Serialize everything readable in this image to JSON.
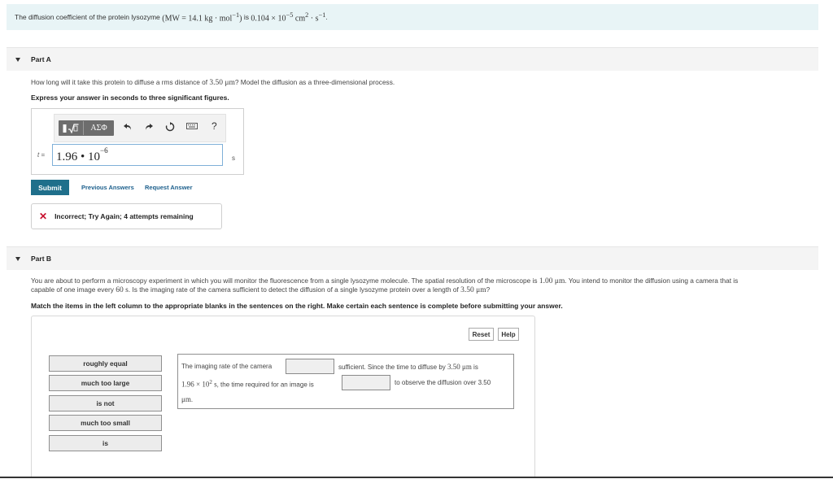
{
  "intro": {
    "text_a": "The diffusion coefficient of the protein lysozyme ",
    "mw": "(MW = 14.1 kg · mol",
    "mw_exp": "−1",
    "mw_close": ")",
    "text_b": " is ",
    "d_value": "0.104 × 10",
    "d_exp": "−5",
    "d_unit": " cm",
    "d_unit_exp": "2",
    "d_unit_b": " · s",
    "d_unit_b_exp": "−1",
    "text_c": "."
  },
  "part_a": {
    "title": "Part A",
    "question_a": "How long will it take this protein to diffuse a rms distance of ",
    "distance": "3.50 μm",
    "question_b": "? Model the diffusion as a three-dimensional process.",
    "instruction": "Express your answer in seconds to three significant figures.",
    "toolbar": {
      "greek_label": "ΑΣΦ",
      "help_label": "?"
    },
    "variable": "t",
    "equals": " =",
    "answer_mantissa": "1.96 • 10",
    "answer_exp": "−6",
    "unit": "s",
    "submit_label": "Submit",
    "previous_answers_label": "Previous Answers",
    "request_answer_label": "Request Answer",
    "feedback": "Incorrect; Try Again; 4 attempts remaining"
  },
  "part_b": {
    "title": "Part B",
    "question_line1_a": "You are about to perform a microscopy experiment in which you will monitor the fluorescence from a single lysozyme molecule. The spatial resolution of the microscope is ",
    "resolution": "1.00 μm",
    "question_line1_b": ". You intend to monitor the diffusion using a camera that is",
    "question_line2_a": "capable of one image every ",
    "interval": "60 s",
    "question_line2_b": ". Is the imaging rate of the camera sufficient to detect the diffusion of a single lysozyme protein over a length of ",
    "length": "3.50 μm",
    "question_line2_c": "?",
    "instruction": "Match the items in the left column to the appropriate blanks in the sentences on the right. Make certain each sentence is complete before submitting your answer.",
    "reset_label": "Reset",
    "help_label": "Help",
    "options": [
      "roughly equal",
      "much too large",
      "is not",
      "much too small",
      "is"
    ],
    "sentence": {
      "s1": "The imaging rate of the camera",
      "s2": "sufficient. Since the time to diffuse by ",
      "s2_math": "3.50 μm",
      "s2_end": " is",
      "s3_math": "1.96 × 10",
      "s3_exp": "2",
      "s3_unit": " s",
      "s3_text": ", the time required for an image is",
      "s4": "to observe the diffusion over 3.50",
      "s5_math": "μm",
      "s5_end": "."
    }
  }
}
